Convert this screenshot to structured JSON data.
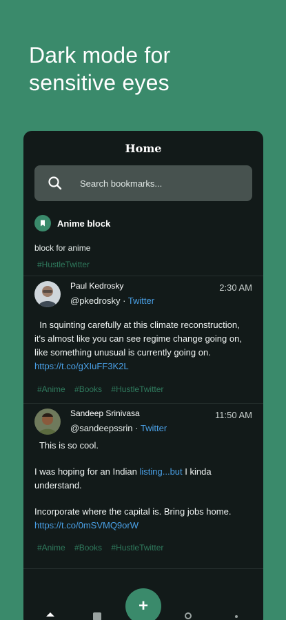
{
  "promo": {
    "line1": "Dark mode for",
    "line2": "sensitive eyes"
  },
  "app": {
    "title": "Home",
    "search_placeholder": "Search bookmarks..."
  },
  "collection": {
    "name": "Anime block",
    "description": "block for anime",
    "tag": "#HustleTwitter",
    "icon": "bookmark-icon"
  },
  "tweets": [
    {
      "name": "Paul Kedrosky",
      "handle": "@pkedrosky",
      "separator": " · ",
      "source": "Twitter",
      "time": "2:30 AM",
      "text_lines": [
        "  In squinting carefully at this climate reconstruction,",
        "it's almost like you can see regime change going on,",
        "like something unusual is currently going on."
      ],
      "link": "https://t.co/gXIuFF3K2L",
      "tags": [
        "#Anime",
        "#Books",
        "#HustleTwitter"
      ]
    },
    {
      "name": "Sandeep Srinivasa",
      "handle": "@sandeepssrin",
      "separator": " · ",
      "source": "Twitter",
      "time": "11:50 AM",
      "line1": "  This is so cool.",
      "line2_pre": "I was hoping for an Indian ",
      "line2_link": "listing...but",
      "line2_post": " I kinda",
      "line3": "understand.",
      "line4": "Incorporate where the capital is. Bring jobs home.",
      "link": "https://t.co/0mSVMQ9orW",
      "tags": [
        "#Anime",
        "#Books",
        "#HustleTwitter"
      ]
    }
  ],
  "nav": {
    "fab_label": "+",
    "items": [
      "home-icon",
      "collections-icon",
      "search-icon",
      "more-icon"
    ]
  },
  "colors": {
    "background": "#3a8a6b",
    "panel": "#121a19",
    "accent": "#3a8a6b",
    "link": "#4aa0e6",
    "tag": "#2f7a5d"
  }
}
